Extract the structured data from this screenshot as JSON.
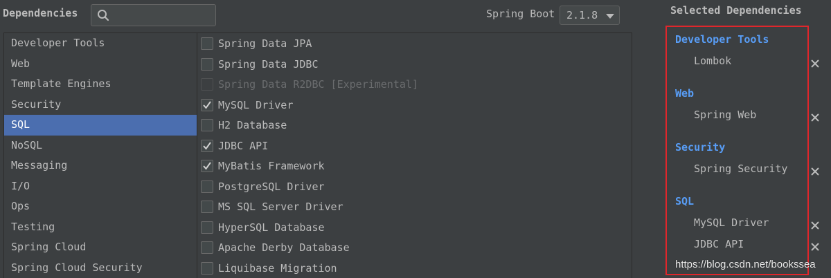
{
  "header": {
    "title": "Dependencies",
    "search": {
      "value": "",
      "placeholder": ""
    },
    "boot_label": "Spring Boot",
    "boot_version": "2.1.8"
  },
  "categories": [
    {
      "label": "Developer Tools",
      "selected": false
    },
    {
      "label": "Web",
      "selected": false
    },
    {
      "label": "Template Engines",
      "selected": false
    },
    {
      "label": "Security",
      "selected": false
    },
    {
      "label": "SQL",
      "selected": true
    },
    {
      "label": "NoSQL",
      "selected": false
    },
    {
      "label": "Messaging",
      "selected": false
    },
    {
      "label": "I/O",
      "selected": false
    },
    {
      "label": "Ops",
      "selected": false
    },
    {
      "label": "Testing",
      "selected": false
    },
    {
      "label": "Spring Cloud",
      "selected": false
    },
    {
      "label": "Spring Cloud Security",
      "selected": false
    }
  ],
  "dependencies": [
    {
      "label": "Spring Data JPA",
      "checked": false,
      "disabled": false
    },
    {
      "label": "Spring Data JDBC",
      "checked": false,
      "disabled": false
    },
    {
      "label": "Spring Data R2DBC [Experimental]",
      "checked": false,
      "disabled": true
    },
    {
      "label": "MySQL Driver",
      "checked": true,
      "disabled": false
    },
    {
      "label": "H2 Database",
      "checked": false,
      "disabled": false
    },
    {
      "label": "JDBC API",
      "checked": true,
      "disabled": false
    },
    {
      "label": "MyBatis Framework",
      "checked": true,
      "disabled": false
    },
    {
      "label": "PostgreSQL Driver",
      "checked": false,
      "disabled": false
    },
    {
      "label": "MS SQL Server Driver",
      "checked": false,
      "disabled": false
    },
    {
      "label": "HyperSQL Database",
      "checked": false,
      "disabled": false
    },
    {
      "label": "Apache Derby Database",
      "checked": false,
      "disabled": false
    },
    {
      "label": "Liquibase Migration",
      "checked": false,
      "disabled": false
    }
  ],
  "selected": {
    "title": "Selected Dependencies",
    "groups": [
      {
        "name": "Developer Tools",
        "items": [
          "Lombok"
        ]
      },
      {
        "name": "Web",
        "items": [
          "Spring Web"
        ]
      },
      {
        "name": "Security",
        "items": [
          "Spring Security"
        ]
      },
      {
        "name": "SQL",
        "items": [
          "MySQL Driver",
          "JDBC API"
        ]
      }
    ]
  },
  "watermark": "https://blog.csdn.net/bookssea",
  "colors": {
    "background": "#3c3f41",
    "selection": "#4b6eaf",
    "group_heading": "#589df6",
    "highlight_box": "#e0262b"
  }
}
